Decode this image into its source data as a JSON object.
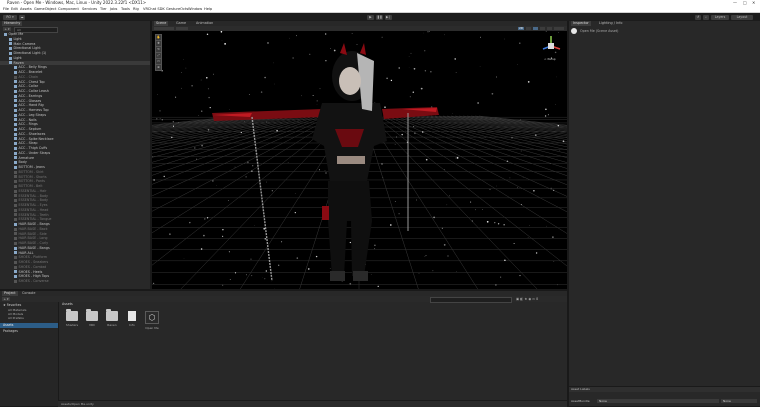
{
  "window": {
    "title": "Raven - Open Me - Windows, Mac, Linux - Unity 2022.3.22f1 <DX11>",
    "controls": [
      "—",
      "□",
      "✕"
    ]
  },
  "menu": [
    "File",
    "Edit",
    "Assets",
    "GameObject",
    "Component",
    "Services",
    "Tier",
    "Jobs",
    "Tools",
    "Rig",
    "VRChat SDK",
    "GestureOcts",
    "Window",
    "Help"
  ],
  "toolbar": {
    "account": "RO ▾",
    "layers": "Layers",
    "layout": "Layout"
  },
  "hierarchy": {
    "tab": "Hierarchy",
    "search_placeholder": "All",
    "rows": [
      {
        "t": "Open Me",
        "d": 0,
        "s": "n"
      },
      {
        "t": "Light",
        "d": 1,
        "s": "n"
      },
      {
        "t": "Main Camera",
        "d": 1,
        "s": "n"
      },
      {
        "t": "Directional Light",
        "d": 1,
        "s": "n"
      },
      {
        "t": "Directional Light (1)",
        "d": 1,
        "s": "n"
      },
      {
        "t": "Light",
        "d": 1,
        "s": "n"
      },
      {
        "t": "Raven",
        "d": 1,
        "s": "sel"
      },
      {
        "t": "ACC - Belly Rings",
        "d": 2,
        "s": "n"
      },
      {
        "t": "ACC - Bracelet",
        "d": 2,
        "s": "n"
      },
      {
        "t": "ACC - Chain",
        "d": 2,
        "s": "d"
      },
      {
        "t": "ACC - Chest Top",
        "d": 2,
        "s": "n"
      },
      {
        "t": "ACC - Collar",
        "d": 2,
        "s": "n"
      },
      {
        "t": "ACC - Collar Leash",
        "d": 2,
        "s": "n"
      },
      {
        "t": "ACC - Earrings",
        "d": 2,
        "s": "n"
      },
      {
        "t": "ACC - Glasses",
        "d": 2,
        "s": "n"
      },
      {
        "t": "ACC - Hand Rig",
        "d": 2,
        "s": "n"
      },
      {
        "t": "ACC - Harness Top",
        "d": 2,
        "s": "n"
      },
      {
        "t": "ACC - Leg Straps",
        "d": 2,
        "s": "n"
      },
      {
        "t": "ACC - Nails",
        "d": 2,
        "s": "n"
      },
      {
        "t": "ACC - Rings",
        "d": 2,
        "s": "n"
      },
      {
        "t": "ACC - Septum",
        "d": 2,
        "s": "n"
      },
      {
        "t": "ACC - Shoelaces",
        "d": 2,
        "s": "n"
      },
      {
        "t": "ACC - Spike Necklace",
        "d": 2,
        "s": "n"
      },
      {
        "t": "ACC - Strap",
        "d": 2,
        "s": "n"
      },
      {
        "t": "ACC - Thigh Cuffs",
        "d": 2,
        "s": "n"
      },
      {
        "t": "ACC - Under Straps",
        "d": 2,
        "s": "n"
      },
      {
        "t": "Armature",
        "d": 2,
        "s": "n"
      },
      {
        "t": "Body",
        "d": 2,
        "s": "n"
      },
      {
        "t": "BOTTOM - Jeans",
        "d": 2,
        "s": "n"
      },
      {
        "t": "BOTTOM - Skirt",
        "d": 2,
        "s": "d"
      },
      {
        "t": "BOTTOM - Shorts",
        "d": 2,
        "s": "d"
      },
      {
        "t": "BOTTOM - Pants",
        "d": 2,
        "s": "d"
      },
      {
        "t": "BOTTOM - Belt",
        "d": 2,
        "s": "d"
      },
      {
        "t": "ESSENTIAL - Hair",
        "d": 2,
        "s": "d"
      },
      {
        "t": "ESSENTIAL - Body",
        "d": 2,
        "s": "d"
      },
      {
        "t": "ESSENTIAL - Body",
        "d": 2,
        "s": "d"
      },
      {
        "t": "ESSENTIAL - Eyes",
        "d": 2,
        "s": "d"
      },
      {
        "t": "ESSENTIAL - Head",
        "d": 2,
        "s": "d"
      },
      {
        "t": "ESSENTIAL - Teeth",
        "d": 2,
        "s": "d"
      },
      {
        "t": "ESSENTIAL - Tongue",
        "d": 2,
        "s": "d"
      },
      {
        "t": "HAIR BASE - Bangs",
        "d": 2,
        "s": "n"
      },
      {
        "t": "HAIR BASE - Back",
        "d": 2,
        "s": "d"
      },
      {
        "t": "HAIR BASE - Side",
        "d": 2,
        "s": "d"
      },
      {
        "t": "HAIR BASE - Long",
        "d": 2,
        "s": "d"
      },
      {
        "t": "HAIR BASE - Curly",
        "d": 2,
        "s": "d"
      },
      {
        "t": "HAIR BASE - Bangs",
        "d": 2,
        "s": "n"
      },
      {
        "t": "HAIR ALL",
        "d": 2,
        "s": "n"
      },
      {
        "t": "SHOES - Platform",
        "d": 2,
        "s": "d"
      },
      {
        "t": "SHOES - Sneakers",
        "d": 2,
        "s": "d"
      },
      {
        "t": "SHOES - Combat",
        "d": 2,
        "s": "d"
      },
      {
        "t": "SHOES - Heels",
        "d": 2,
        "s": "n"
      },
      {
        "t": "SHOES - High Tops",
        "d": 2,
        "s": "n"
      },
      {
        "t": "SHOES - Converse",
        "d": 2,
        "s": "d"
      }
    ]
  },
  "scene": {
    "tabs": [
      "Scene",
      "Game",
      "Animation"
    ],
    "view_label": "2D",
    "projection": "< Persp"
  },
  "inspector": {
    "tabs": [
      "Inspector",
      "Lighting / Info"
    ],
    "message": "Open Me (Scene Asset)",
    "asset_labels": "Asset Labels",
    "asset_bundle_label": "AssetBundle",
    "asset_bundle_value": "None",
    "variant_value": "None"
  },
  "project": {
    "tabs": [
      "Project",
      "Console"
    ],
    "favorites_label": "Favorites",
    "favorites": [
      "All Materials",
      "All Models",
      "All Prefabs"
    ],
    "assets_label": "Assets",
    "packages_label": "Packages",
    "breadcrumb": "Assets",
    "assets": [
      {
        "name": "Shaders",
        "kind": "folder"
      },
      {
        "name": "VRC",
        "kind": "folder"
      },
      {
        "name": "Raven",
        "kind": "folder"
      },
      {
        "name": "Info",
        "kind": "doc"
      },
      {
        "name": "Open Me",
        "kind": "unity"
      }
    ],
    "footer": "Assets/Open Me.unity"
  }
}
